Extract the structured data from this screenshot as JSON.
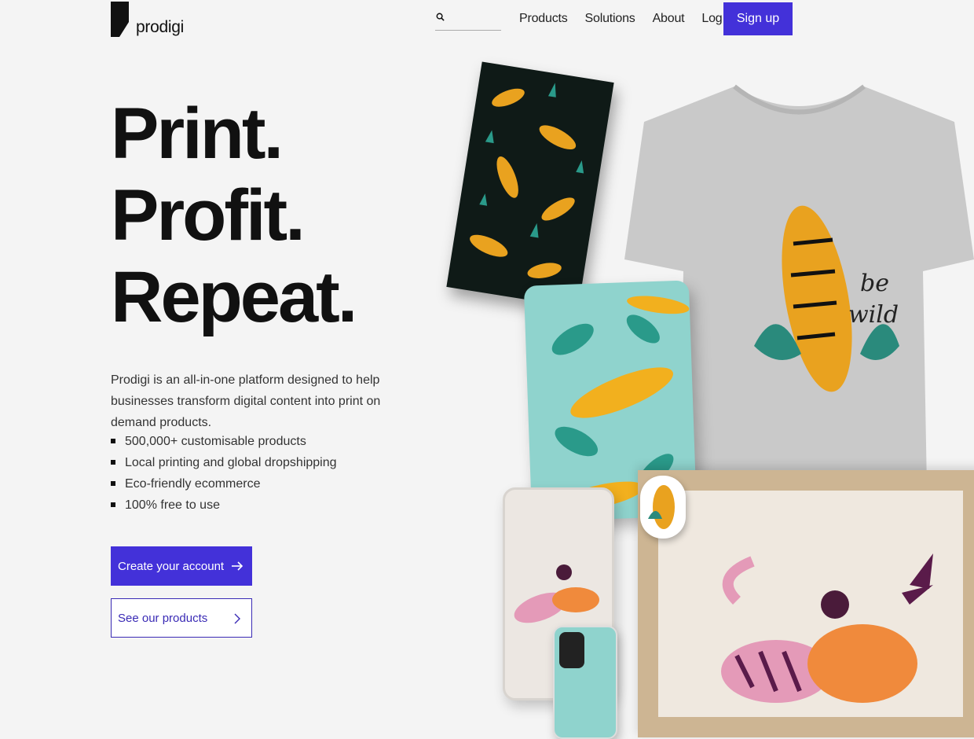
{
  "brand": {
    "name": "prodigi"
  },
  "search": {
    "placeholder": "",
    "value": ""
  },
  "nav": {
    "products": "Products",
    "solutions": "Solutions",
    "about": "About",
    "login": "Log in",
    "signup": "Sign up"
  },
  "hero": {
    "headline": [
      "Print.",
      "Profit.",
      "Repeat."
    ],
    "intro": "Prodigi is an all-in-one platform designed to help businesses transform digital content into print on demand products.",
    "features": [
      "500,000+ customisable products",
      "Local printing and global dropshipping",
      "Eco-friendly ecommerce",
      "100% free to use"
    ],
    "cta_primary": "Create your account",
    "cta_secondary": "See our products"
  },
  "colors": {
    "accent": "#4331d9",
    "background": "#f4f4f4",
    "text": "#111111"
  },
  "icons": {
    "search": "search-icon",
    "arrow": "arrow-right-icon",
    "chevron": "chevron-right-icon"
  }
}
